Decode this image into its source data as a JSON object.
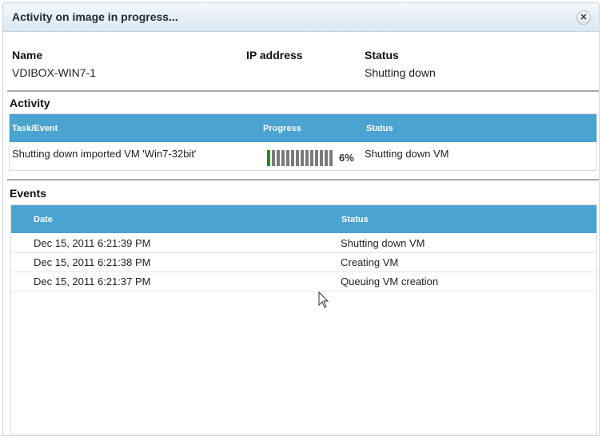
{
  "dialog": {
    "title": "Activity on image in progress..."
  },
  "info": {
    "name_label": "Name",
    "name_value": "VDIBOX-WIN7-1",
    "ip_label": "IP address",
    "ip_value": "",
    "status_label": "Status",
    "status_value": "Shutting down"
  },
  "activity": {
    "section_title": "Activity",
    "headers": [
      "Task/Event",
      "Progress",
      "Status"
    ],
    "row": {
      "task": "Shutting down imported VM 'Win7-32bit'",
      "progress_fraction": 0.06,
      "progress_text": "6%",
      "status": "Shutting down VM"
    }
  },
  "events": {
    "section_title": "Events",
    "headers": [
      "Date",
      "Status"
    ],
    "rows": [
      {
        "date": "Dec 15, 2011 6:21:39 PM",
        "status": "Shutting down VM"
      },
      {
        "date": "Dec 15, 2011 6:21:38 PM",
        "status": "Creating VM"
      },
      {
        "date": "Dec 15, 2011 6:21:37 PM",
        "status": "Queuing VM creation"
      }
    ]
  },
  "icons": {
    "close": "close-icon",
    "cursor": "mouse-pointer-icon"
  },
  "colors": {
    "header_blue": "#4aa3d1",
    "progress_green": "#1d8f1d",
    "progress_gray": "#7a7a7a"
  }
}
